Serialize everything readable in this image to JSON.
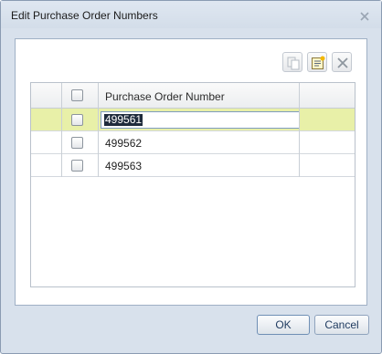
{
  "window": {
    "title": "Edit Purchase Order Numbers",
    "close_icon": "close-x-icon"
  },
  "toolbar": {
    "copy_icon": "copy-icon",
    "add_icon": "add-note-icon",
    "delete_icon": "delete-x-icon"
  },
  "grid": {
    "column_header": "Purchase Order Number",
    "rows": [
      {
        "value": "499561",
        "selected": true,
        "editing": true
      },
      {
        "value": "499562",
        "selected": false,
        "editing": false
      },
      {
        "value": "499563",
        "selected": false,
        "editing": false
      }
    ]
  },
  "buttons": {
    "ok": "OK",
    "cancel": "Cancel"
  },
  "colors": {
    "selected_row": "#e8f0a8",
    "dialog_bg": "#d8e1ec"
  }
}
